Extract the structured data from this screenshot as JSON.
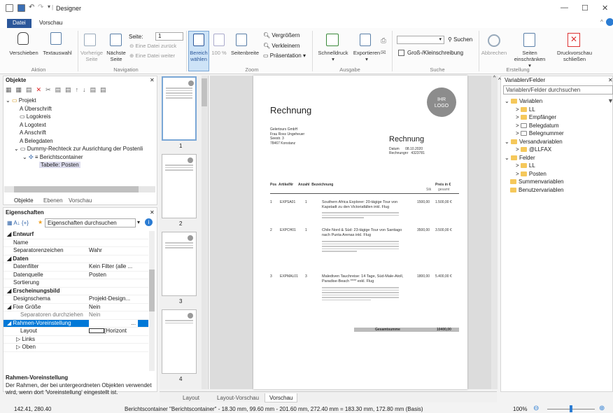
{
  "titlebar": {
    "title": "Designer"
  },
  "tabs": [
    "Datei",
    "Vorschau"
  ],
  "ribbon": {
    "aktion": {
      "buttons": [
        "Verschieben",
        "Textauswahl"
      ],
      "group": "Aktion"
    },
    "navigation": {
      "btn1": "Vorherige Seite",
      "btn2": "Nächste Seite",
      "seite_label": "Seite:",
      "seite_value": "1",
      "zurueck": "Eine Datei zurück",
      "weiter": "Eine Datei weiter",
      "group": "Navigation"
    },
    "zoom": {
      "bereich": "Bereich wählen",
      "pct": "100 %",
      "seitenbreite": "Seitenbreite",
      "vergroessern": "Vergrößern",
      "verkleinern": "Verkleinern",
      "praesentation": "Präsentation",
      "group": "Zoom"
    },
    "ausgabe": {
      "schnelldruck": "Schnelldruck",
      "exportieren": "Exportieren",
      "group": "Ausgabe"
    },
    "suche": {
      "suchen": "Suchen",
      "gross": "Groß-/Kleinschreibung",
      "group": "Suche"
    },
    "erstellung": {
      "abbrechen": "Abbrechen",
      "seiten": "Seiten einschränken",
      "schliessen": "Druckvorschau schließen",
      "group": "Erstellung"
    }
  },
  "objekte": {
    "title": "Objekte",
    "items": [
      "Projekt",
      "Überschrift",
      "Logokreis",
      "Logotext",
      "Anschrift",
      "Belegdaten",
      "Dummy-Rechteck zur Ausrichtung der Postenli",
      "Berichtscontainer",
      "Tabelle: Posten"
    ],
    "tabs": [
      "Objekte",
      "Ebenen",
      "Vorschau"
    ]
  },
  "eigenschaften": {
    "title": "Eigenschaften",
    "search": "Eigenschaften durchsuchen",
    "rows": [
      {
        "k": "Entwurf",
        "v": "",
        "sec": true
      },
      {
        "k": "Name",
        "v": ""
      },
      {
        "k": "Separatorenzeichen",
        "v": "Wahr"
      },
      {
        "k": "Daten",
        "v": "",
        "sec": true
      },
      {
        "k": "Datenfilter",
        "v": "Kein Filter (alle ..."
      },
      {
        "k": "Datenquelle",
        "v": "Posten"
      },
      {
        "k": "Sortierung",
        "v": ""
      },
      {
        "k": "Erscheinungsbild",
        "v": "",
        "sec": true
      },
      {
        "k": "Designschema",
        "v": "Projekt-Design..."
      },
      {
        "k": "Fixe Größe",
        "v": "Nein",
        "sec2": true
      },
      {
        "k": "Separatoren durchziehen",
        "v": "Nein"
      },
      {
        "k": "Rahmen-Voreinstellung",
        "v": "",
        "sel": true
      },
      {
        "k": "Layout",
        "v": "[Horizont"
      },
      {
        "k": "Links",
        "v": ""
      },
      {
        "k": "Oben",
        "v": ""
      }
    ],
    "help_title": "Rahmen-Voreinstellung",
    "help_text": "Der Rahmen, der bei untergeordneten Objekten verwendet wird, wenn dort 'Voreinstellung' eingestellt ist."
  },
  "thumbs": [
    "1",
    "2",
    "3",
    "4"
  ],
  "doc": {
    "title": "Rechnung",
    "logo1": "IHR",
    "logo2": "LOGO",
    "addr": [
      "Gelertours GmbH",
      "Frau Ross Ungeheuer",
      "Seestr. 3",
      "78467 Konstanz"
    ],
    "title2": "Rechnung",
    "datum_l": "Datum",
    "datum_v": "08.10.2020",
    "nr_l": "Rechnungnr",
    "nr_v": "4323781",
    "cols": [
      "Pos",
      "ArtikelNr",
      "Anzahl",
      "Bezeichnung",
      "Preis in €"
    ],
    "sub": [
      "Stk",
      "gesamt"
    ],
    "rows": [
      {
        "pos": "1",
        "art": "EXPSA01",
        "anz": "1",
        "bez": "Southern Africa Explorer: 20-tägige Tour von Kapstadt zu den Victoriafällen inkl. Flug",
        "p": "1500,00",
        "g": "1.500,00 €"
      },
      {
        "pos": "2",
        "art": "EXPCH01",
        "anz": "1",
        "bez": "Chile Nord & Süd: 23-tägige Tour von Santiago nach Punta Arenas inkl. Flug",
        "p": "3500,00",
        "g": "3.500,00 €"
      },
      {
        "pos": "3",
        "art": "EXPMAL01",
        "anz": "3",
        "bez": "Malediven Tauchreise: 14 Tage, Süd-Male-Atoll, Paradise-Beach **** exkl. Flug",
        "p": "1800,00",
        "g": "5.400,00 €"
      }
    ],
    "sum_l": "Gesamtsumme",
    "sum_v": "10400,00"
  },
  "bottom_tabs": [
    "Layout",
    "Layout-Vorschau",
    "Vorschau"
  ],
  "variablen": {
    "title": "Variablen/Felder",
    "search": "Variablen/Felder durchsuchen",
    "items": [
      "Variablen",
      "LL",
      "Empfänger",
      "Belegdatum",
      "Belegnummer",
      "Versandvariablen",
      "@LLFAX",
      "Felder",
      "LL",
      "Posten",
      "Summenvariablen",
      "Benutzervariablen"
    ]
  },
  "status": {
    "coords": "142.41, 280.40",
    "info": "Berichtscontainer \"Berichtscontainer\" - 18.30 mm, 99.60 mm - 201.60 mm, 272.40 mm = 183.30 mm, 172.80 mm (Basis)",
    "zoom": "100%"
  }
}
